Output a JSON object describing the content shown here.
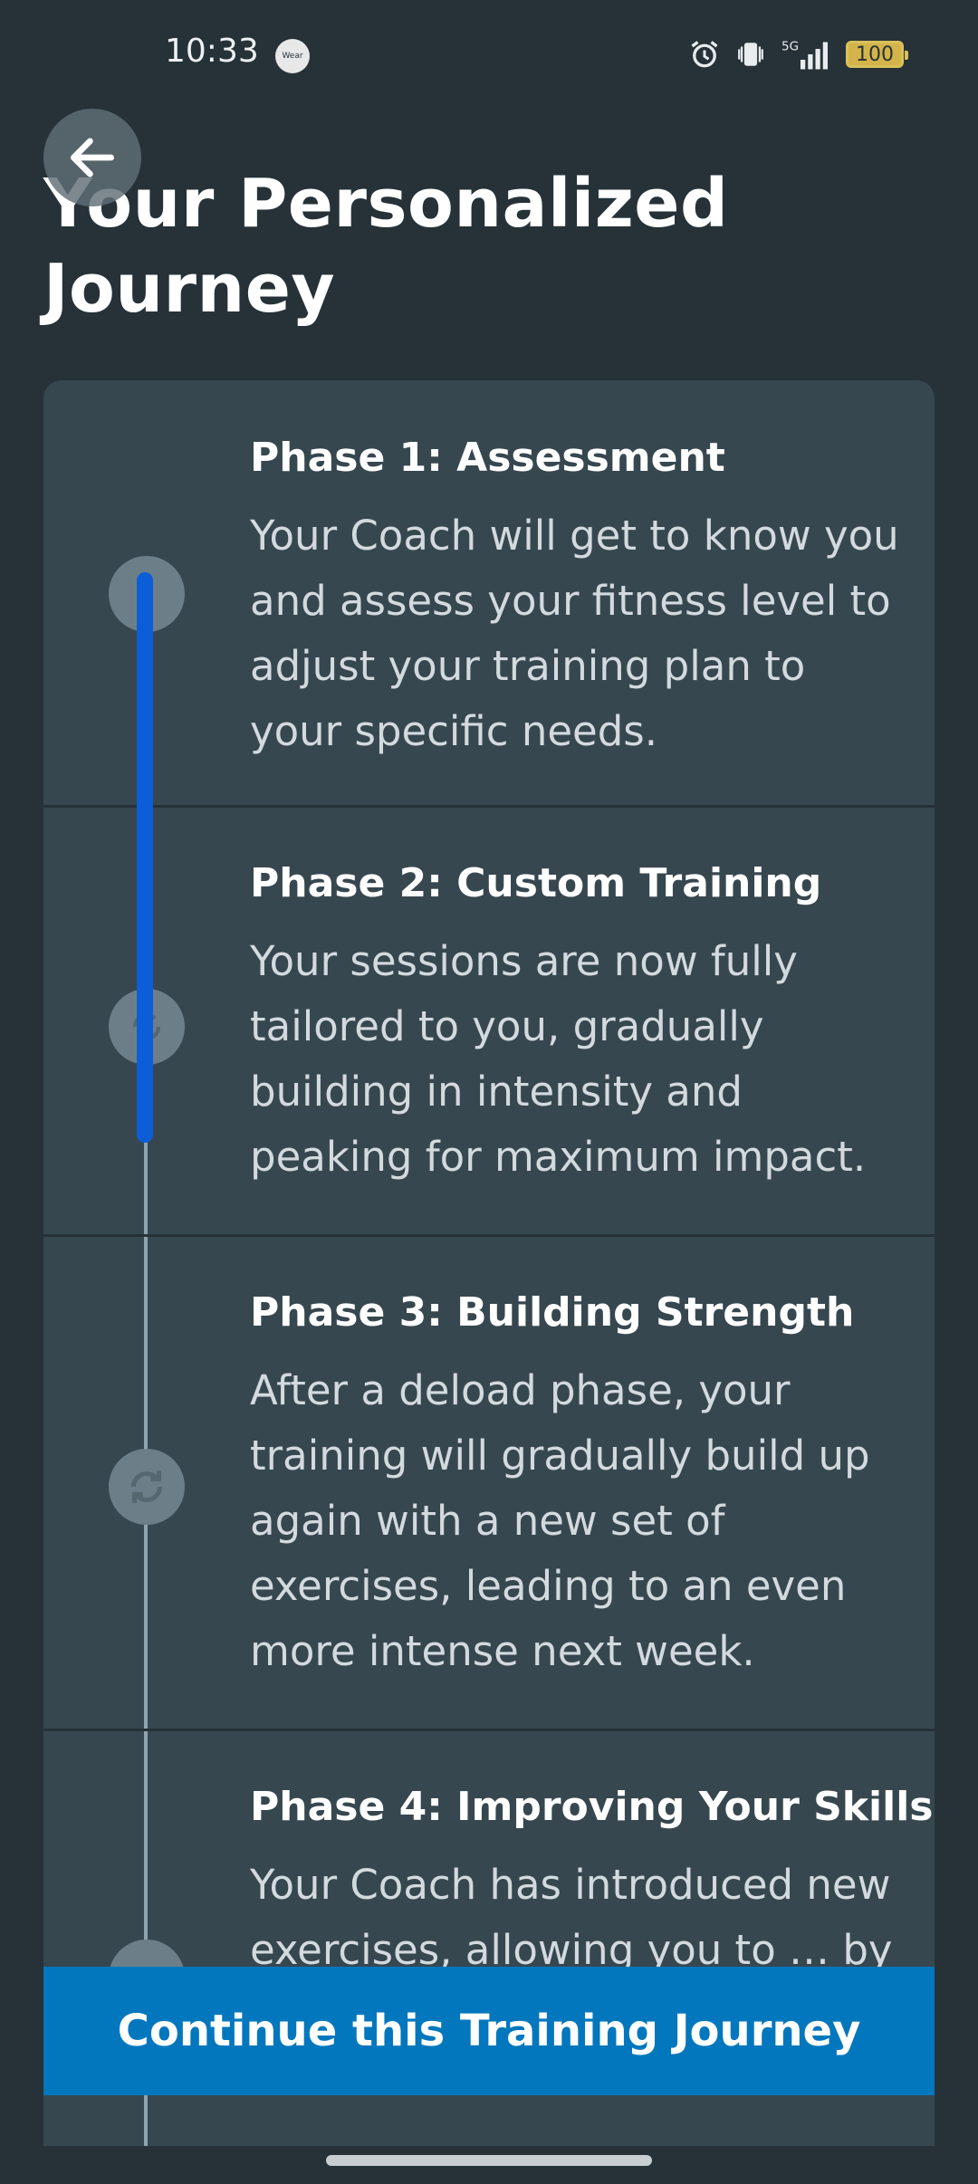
{
  "status_bar": {
    "time": "10:33",
    "wear_label": "Wear",
    "battery": "100",
    "network": "5G",
    "icons": [
      "alarm-icon",
      "vibrate-icon",
      "signal-icon",
      "battery-icon"
    ]
  },
  "header": {
    "title": "Your Personalized Journey",
    "back_icon": "arrow-left-icon"
  },
  "timeline": {
    "progress_color": "#0b5ed7",
    "phases": [
      {
        "title": "Phase 1: Assessment",
        "description": "Your Coach will get to know you and assess your fitness level to adjust your training plan to your specific needs."
      },
      {
        "title": "Phase 2: Custom Training",
        "description": "Your sessions are now fully tailored to you, gradually building in intensity and peaking for maximum impact."
      },
      {
        "title": "Phase 3: Building Strength",
        "description": "After a deload phase, your training will gradually build up again with a new set of exercises, leading to an even more intense next week."
      },
      {
        "title": "Phase 4: Improving Your Skills",
        "description": "Your Coach has introduced new exercises, allowing you to … by gradually increasing training …"
      }
    ]
  },
  "footer": {
    "continue_label": "Continue this Training Journey",
    "accent_color": "#0277bd"
  }
}
